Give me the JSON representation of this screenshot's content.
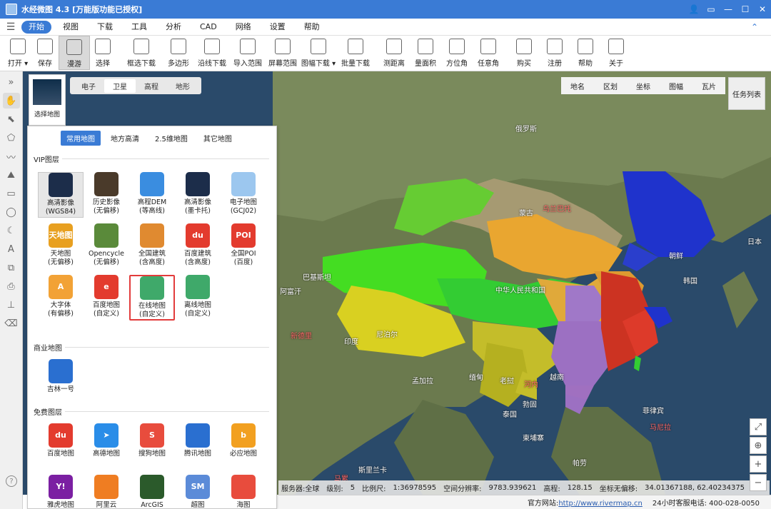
{
  "app": {
    "title": "水经微图 4.3 [万能版功能已授权]"
  },
  "menu": {
    "items": [
      "开始",
      "视图",
      "下载",
      "工具",
      "分析",
      "CAD",
      "网络",
      "设置",
      "帮助"
    ],
    "active": 0
  },
  "toolbar": {
    "items": [
      {
        "label": "打开 ▾",
        "icon": "folder-icon"
      },
      {
        "label": "保存",
        "icon": "save-icon"
      },
      {
        "label": "漫游",
        "icon": "hand-icon",
        "pressed": true
      },
      {
        "label": "选择",
        "icon": "cursor-icon"
      },
      {
        "label": "框选下载",
        "icon": "box-download-icon"
      },
      {
        "label": "多边形",
        "icon": "polygon-icon"
      },
      {
        "label": "沿线下载",
        "icon": "line-download-icon"
      },
      {
        "label": "导入范围",
        "icon": "import-range-icon"
      },
      {
        "label": "屏幕范围",
        "icon": "screen-range-icon"
      },
      {
        "label": "图幅下载 ▾",
        "icon": "sheet-download-icon"
      },
      {
        "label": "批量下载",
        "icon": "batch-download-icon"
      },
      {
        "label": "测距离",
        "icon": "ruler-icon"
      },
      {
        "label": "量面积",
        "icon": "area-icon"
      },
      {
        "label": "方位角",
        "icon": "azimuth-icon"
      },
      {
        "label": "任意角",
        "icon": "angle-icon"
      },
      {
        "label": "购买",
        "icon": "cart-icon"
      },
      {
        "label": "注册",
        "icon": "register-icon"
      },
      {
        "label": "帮助",
        "icon": "help-icon"
      },
      {
        "label": "关于",
        "icon": "info-icon"
      }
    ]
  },
  "map_tabs": {
    "items": [
      "电子",
      "卫星",
      "高程",
      "地形"
    ],
    "active": 1
  },
  "overlay_tabs": {
    "items": [
      "地名",
      "区划",
      "坐标",
      "图幅",
      "瓦片"
    ]
  },
  "task_list": "任务列表",
  "select_map": "选择地图",
  "panel": {
    "tabs": [
      "常用地图",
      "地方高清",
      "2.5维地图",
      "其它地图"
    ],
    "active_tab": 0,
    "vip_title": "VIP图层",
    "vip": [
      {
        "l1": "高清影像",
        "l2": "(WGS84)",
        "color": "#1c2d4a",
        "icon": "satellite-icon",
        "pressed": true
      },
      {
        "l1": "历史影像",
        "l2": "(无偏移)",
        "color": "#4a3a2a",
        "icon": "history-icon"
      },
      {
        "l1": "高程DEM",
        "l2": "(等高线)",
        "color": "#3a8de0",
        "icon": "dem-icon"
      },
      {
        "l1": "高清影像",
        "l2": "(墨卡托)",
        "color": "#1c2d4a",
        "icon": "mercator-icon"
      },
      {
        "l1": "电子地图",
        "l2": "(GCJ02)",
        "color": "#9cc7ef",
        "icon": "map-icon"
      },
      {
        "l1": "天地图",
        "l2": "(无偏移)",
        "color": "#e8a020",
        "icon": "tianditu-icon",
        "text": "天地图"
      },
      {
        "l1": "Opencycle",
        "l2": "(无偏移)",
        "color": "#5a8a3a",
        "icon": "opencycle-icon"
      },
      {
        "l1": "全国建筑",
        "l2": "(含高度)",
        "color": "#e08a30",
        "icon": "building-icon"
      },
      {
        "l1": "百度建筑",
        "l2": "(含高度)",
        "color": "#e33b2e",
        "icon": "baidu-building-icon",
        "text": "du"
      },
      {
        "l1": "全国POI",
        "l2": "(百度)",
        "color": "#e33b2e",
        "icon": "poi-icon",
        "text": "POI"
      },
      {
        "l1": "大字体",
        "l2": "(有偏移)",
        "color": "#f2a236",
        "icon": "large-font-icon",
        "text": "A"
      },
      {
        "l1": "百度地图",
        "l2": "(自定义)",
        "color": "#e33b2e",
        "icon": "baidu-custom-icon",
        "text": "e"
      },
      {
        "l1": "在线地图",
        "l2": "(自定义)",
        "color": "#3fa96a",
        "icon": "online-map-icon",
        "highlight": true
      },
      {
        "l1": "离线地图",
        "l2": "(自定义)",
        "color": "#3fa96a",
        "icon": "offline-map-icon"
      }
    ],
    "commercial_title": "商业地图",
    "commercial": [
      {
        "l1": "吉林一号",
        "l2": "",
        "color": "#2a6fd0",
        "icon": "jilin-icon"
      }
    ],
    "free_title": "免费图层",
    "free": [
      {
        "l1": "百度地图",
        "l2": "",
        "color": "#e33b2e",
        "icon": "baidu-icon",
        "text": "du"
      },
      {
        "l1": "高德地图",
        "l2": "",
        "color": "#2a8de8",
        "icon": "amap-icon",
        "text": "➤"
      },
      {
        "l1": "搜狗地图",
        "l2": "",
        "color": "#e84c3d",
        "icon": "sogou-icon",
        "text": "S"
      },
      {
        "l1": "腾讯地图",
        "l2": "",
        "color": "#2a6fd0",
        "icon": "tencent-icon"
      },
      {
        "l1": "必应地图",
        "l2": "",
        "color": "#f2a020",
        "icon": "bing-icon",
        "text": "b"
      },
      {
        "l1": "雅虎地图",
        "l2": "",
        "color": "#7b1fa2",
        "icon": "yahoo-icon",
        "text": "Y!"
      },
      {
        "l1": "阿里云",
        "l2": "",
        "color": "#ef7d22",
        "icon": "aliyun-icon"
      },
      {
        "l1": "ArcGIS",
        "l2": "",
        "color": "#2b5a2b",
        "icon": "arcgis-icon"
      },
      {
        "l1": "超图",
        "l2": "",
        "color": "#5b8bd8",
        "icon": "supermap-icon",
        "text": "SM"
      },
      {
        "l1": "海图",
        "l2": "",
        "color": "#e84c3d",
        "icon": "seachart-icon"
      }
    ]
  },
  "map_labels": [
    {
      "text": "俄罗斯",
      "red": false
    },
    {
      "text": "蒙古",
      "red": false
    },
    {
      "text": "中华人民共和国",
      "red": false
    },
    {
      "text": "朝鲜",
      "red": false
    },
    {
      "text": "韩国",
      "red": false
    },
    {
      "text": "日本",
      "red": false
    },
    {
      "text": "印度",
      "red": false
    },
    {
      "text": "尼泊尔",
      "red": false
    },
    {
      "text": "孟加拉",
      "red": false
    },
    {
      "text": "缅甸",
      "red": false
    },
    {
      "text": "泰国",
      "red": false
    },
    {
      "text": "老挝",
      "red": false
    },
    {
      "text": "越南",
      "red": false
    },
    {
      "text": "柬埔寨",
      "red": false
    },
    {
      "text": "菲律宾",
      "red": false
    },
    {
      "text": "马尼拉",
      "red": true
    },
    {
      "text": "斯里兰卡",
      "red": false
    },
    {
      "text": "勃固",
      "red": false
    },
    {
      "text": "帕劳",
      "red": false
    },
    {
      "text": "新德里",
      "red": true
    },
    {
      "text": "河内",
      "red": true
    },
    {
      "text": "乌兰巴托",
      "red": true
    },
    {
      "text": "巴基斯坦",
      "red": false
    },
    {
      "text": "阿富汗",
      "red": false
    },
    {
      "text": "马累",
      "red": true
    }
  ],
  "status": {
    "server": "服务器:全球",
    "level_label": "级别:",
    "level": "5",
    "scale_label": "比例尺:",
    "scale": "1:36978595",
    "resolution_label": "空间分辨率:",
    "resolution": "9783.939621",
    "elevation_label": "高程:",
    "elevation": "128.15",
    "coord_label": "坐标无偏移:",
    "coord": "34.01367188, 62.40234375"
  },
  "footer": {
    "site_label": "官方网站:",
    "site": "http://www.rivermap.cn",
    "phone": "24小时客服电话: 400-028-0050"
  }
}
